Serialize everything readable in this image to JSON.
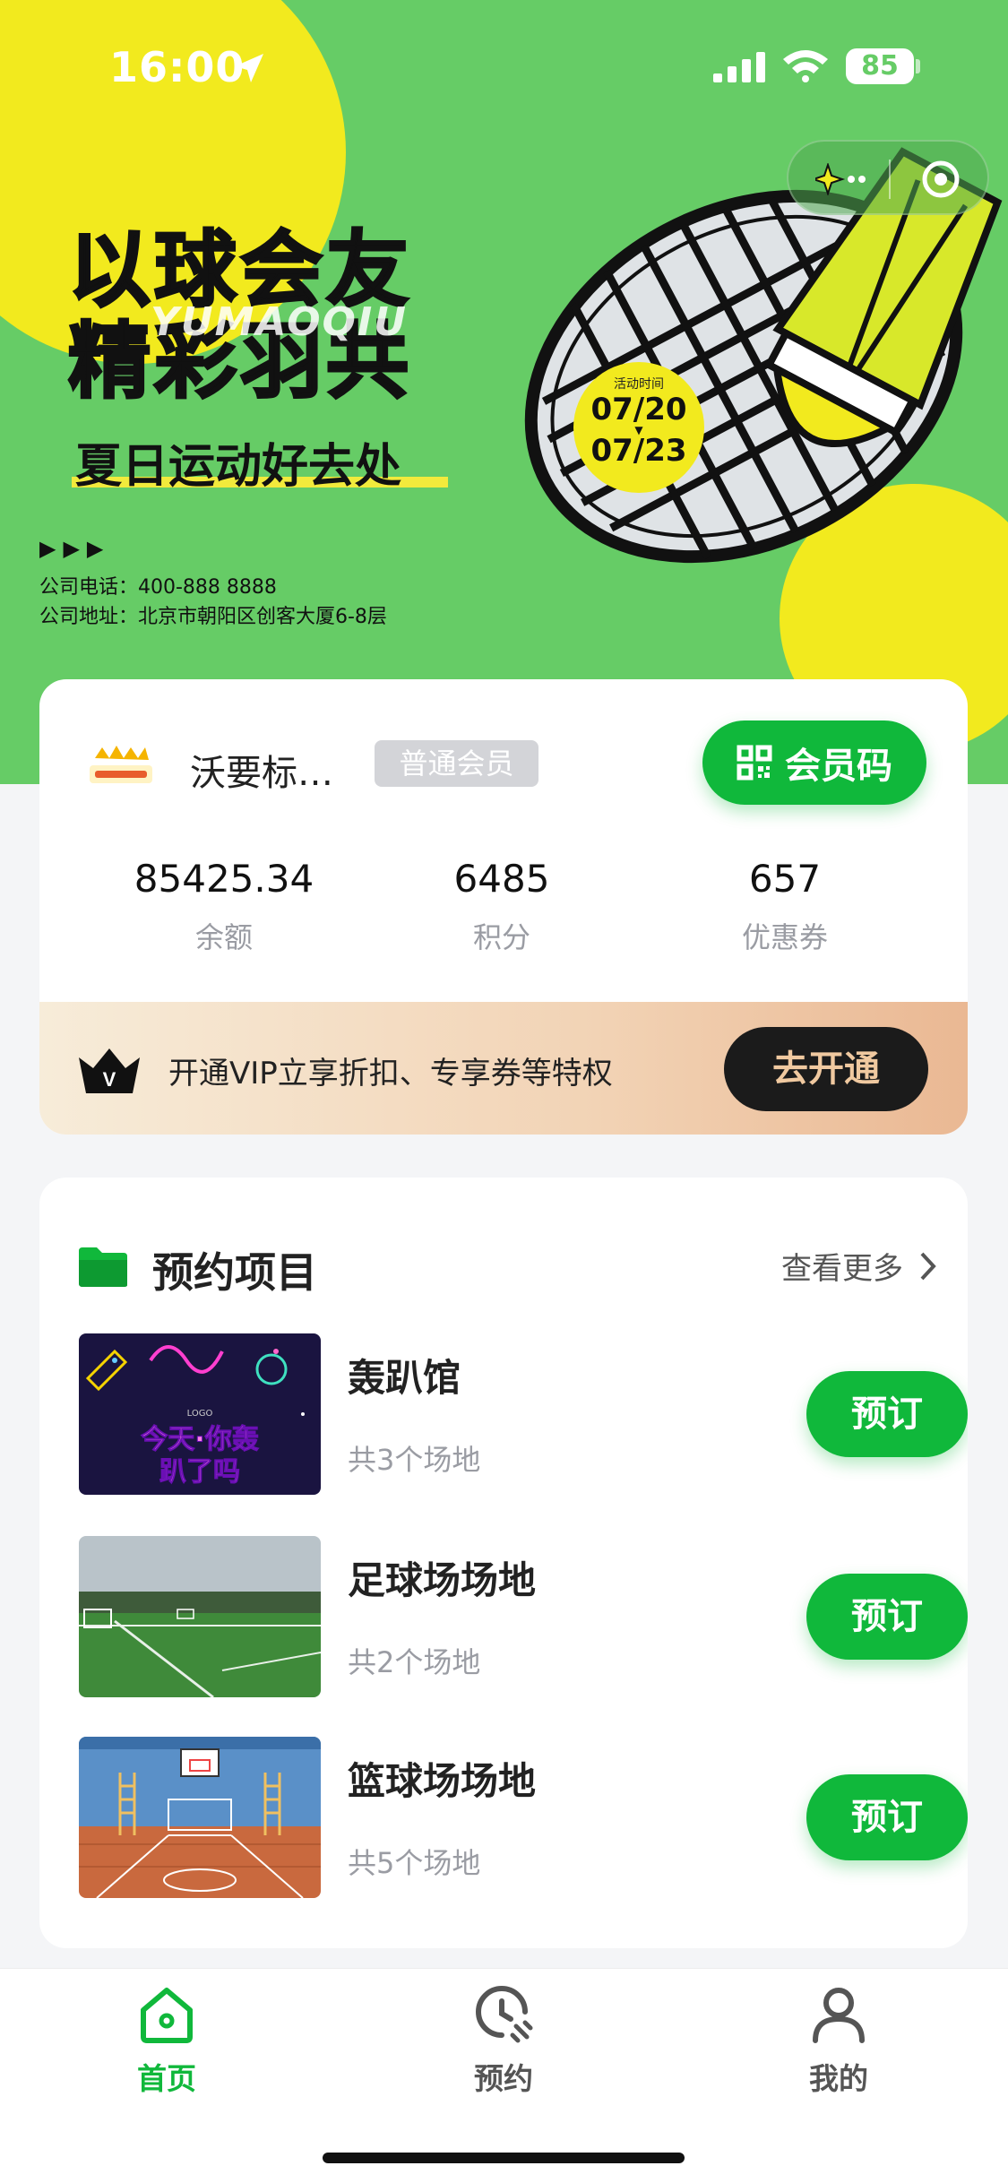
{
  "status_bar": {
    "time": "16:00",
    "battery": "85"
  },
  "banner": {
    "title_line1": "以球会友",
    "title_line2": "精彩羽共",
    "watermark": "YUMAOQIU",
    "subtitle": "夏日运动好去处",
    "arrows": "▶▶▶",
    "phone": "公司电话：400-888 8888",
    "address": "公司地址：北京市朝阳区创客大厦6-8层",
    "event_label": "活动时间",
    "date_start": "07/20",
    "date_end": "07/23"
  },
  "member": {
    "name": "沃要标…",
    "level": "普通会员",
    "code_button": "会员码",
    "stats": [
      {
        "value": "85425.34",
        "label": "余额"
      },
      {
        "value": "6485",
        "label": "积分"
      },
      {
        "value": "657",
        "label": "优惠券"
      }
    ],
    "vip_text": "开通VIP立享折扣、专享券等特权",
    "vip_button": "去开通"
  },
  "booking": {
    "title": "预约项目",
    "more": "查看更多",
    "venues": [
      {
        "name": "轰趴馆",
        "count": "共3个场地",
        "button": "预订"
      },
      {
        "name": "足球场场地",
        "count": "共2个场地",
        "button": "预订"
      },
      {
        "name": "篮球场场地",
        "count": "共5个场地",
        "button": "预订"
      }
    ]
  },
  "tabs": [
    {
      "label": "首页",
      "icon": "home-icon",
      "active": true
    },
    {
      "label": "预约",
      "icon": "clock-icon",
      "active": false
    },
    {
      "label": "我的",
      "icon": "user-icon",
      "active": false
    }
  ],
  "colors": {
    "brand_green": "#10b83b",
    "banner_green": "#66cc66",
    "accent_yellow": "#f2ea1e"
  }
}
